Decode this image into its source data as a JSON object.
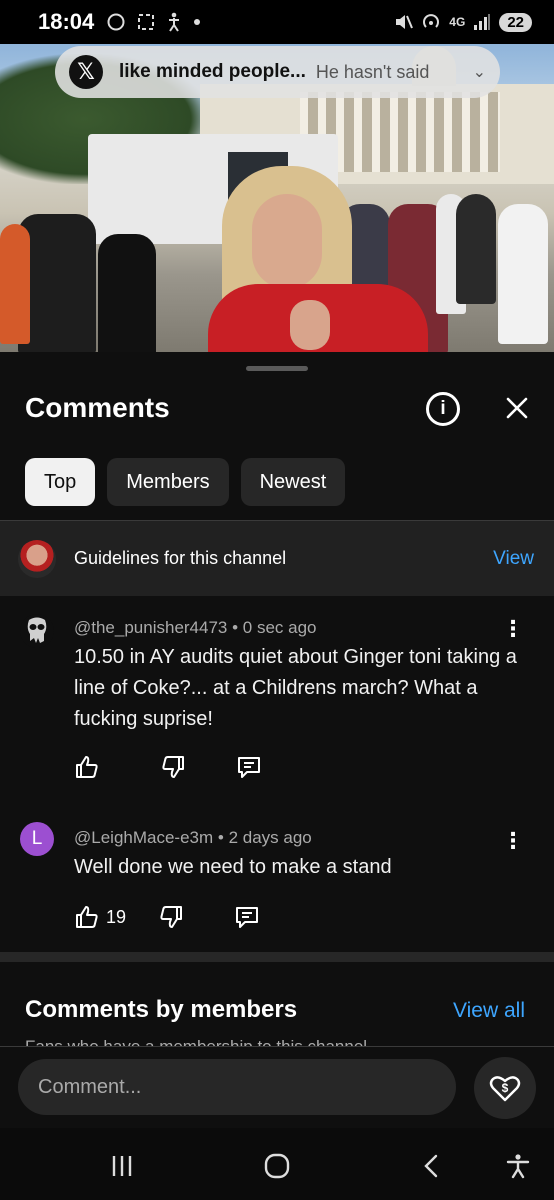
{
  "status_bar": {
    "time": "18:04",
    "network": "4G",
    "battery": "22",
    "icons": [
      "whatsapp-icon",
      "screen-capture-icon",
      "accessibility-person-icon",
      "dot-icon",
      "mute-icon",
      "hotspot-icon",
      "signal-icon"
    ]
  },
  "notification": {
    "app_icon": "x-logo-icon",
    "title": "like minded people...",
    "text": "He hasn't said"
  },
  "sheet": {
    "title": "Comments",
    "filters": [
      {
        "label": "Top",
        "active": true
      },
      {
        "label": "Members",
        "active": false
      },
      {
        "label": "Newest",
        "active": false
      }
    ],
    "guidelines": {
      "label": "Guidelines for this channel",
      "action": "View"
    }
  },
  "comments": [
    {
      "author": "@the_punisher4473",
      "time": "0 sec ago",
      "text": "10.50  in AY audits quiet about Ginger toni taking a line of Coke?... at a Childrens march? What a fucking suprise!",
      "likes": ""
    },
    {
      "author": "@LeighMace-e3m",
      "time": "2 days ago",
      "avatar_letter": "L",
      "avatar_color": "#9c4fd1",
      "text": "Well done we need to make a stand",
      "likes": "19"
    }
  ],
  "members_section": {
    "title": "Comments by members",
    "action": "View all",
    "subtitle": "Fans who have a membership to this channel"
  },
  "composer": {
    "placeholder": "Comment..."
  },
  "colors": {
    "background": "#0f0f0f",
    "chip": "#272727",
    "link": "#3ea6ff"
  }
}
